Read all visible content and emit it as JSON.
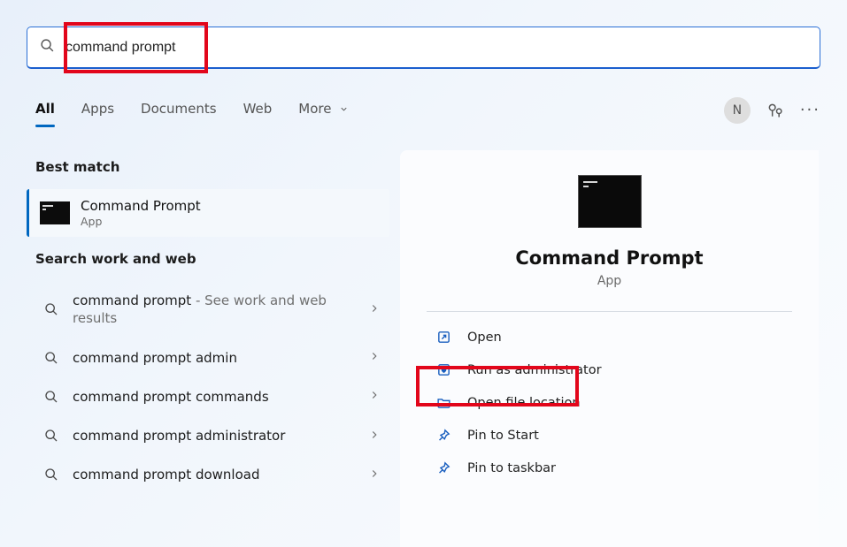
{
  "search": {
    "value": "command prompt"
  },
  "tabs": {
    "all": "All",
    "apps": "Apps",
    "documents": "Documents",
    "web": "Web",
    "more": "More"
  },
  "avatar_initial": "N",
  "left": {
    "best_match_label": "Best match",
    "best_title": "Command Prompt",
    "best_sub": "App",
    "work_web_label": "Search work and web",
    "suggestions": [
      {
        "text": "command prompt",
        "hint": " - See work and web results"
      },
      {
        "text": "command prompt admin",
        "hint": ""
      },
      {
        "text": "command prompt commands",
        "hint": ""
      },
      {
        "text": "command prompt administrator",
        "hint": ""
      },
      {
        "text": "command prompt download",
        "hint": ""
      }
    ]
  },
  "preview": {
    "title": "Command Prompt",
    "sub": "App",
    "actions": {
      "open": "Open",
      "run_admin": "Run as administrator",
      "open_loc": "Open file location",
      "pin_start": "Pin to Start",
      "pin_taskbar": "Pin to taskbar"
    }
  }
}
